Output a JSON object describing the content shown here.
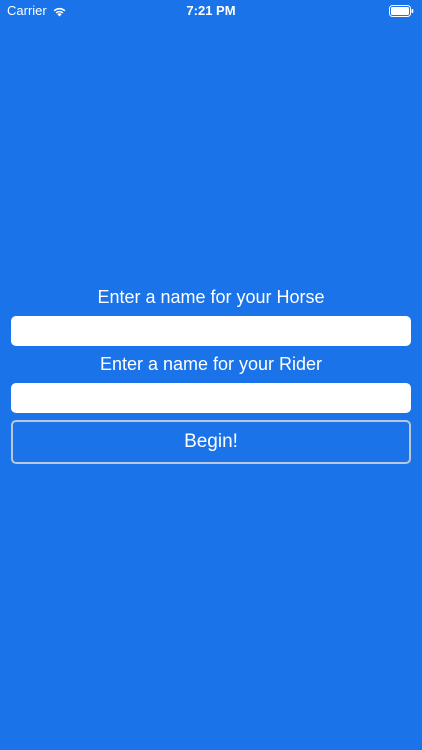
{
  "status_bar": {
    "carrier": "Carrier",
    "time": "7:21 PM",
    "icons": [
      "wifi-icon",
      "battery-icon"
    ]
  },
  "form": {
    "horse_label": "Enter a name for your Horse",
    "horse_value": "",
    "rider_label": "Enter a name for your Rider",
    "rider_value": "",
    "begin_label": "Begin!"
  },
  "colors": {
    "background": "#1a73e8",
    "text": "#ffffff",
    "field": "#ffffff",
    "button_border": "#b9c7dc"
  }
}
